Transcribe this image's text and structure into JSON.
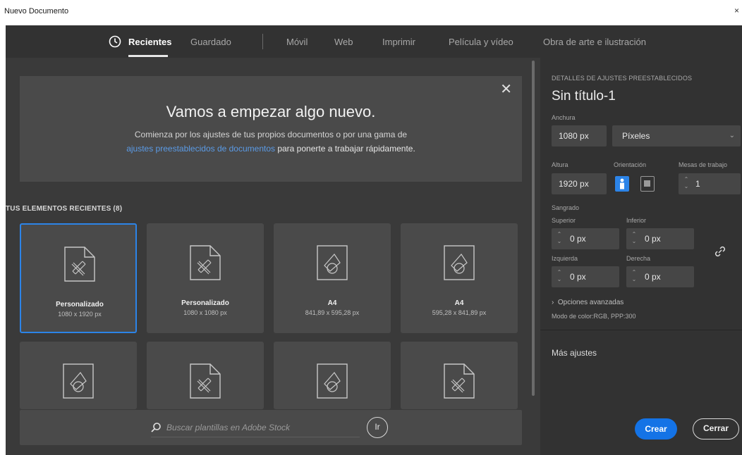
{
  "window": {
    "title": "Nuevo Documento"
  },
  "tabs": [
    {
      "label": "Recientes",
      "active": true
    },
    {
      "label": "Guardado"
    },
    {
      "label": "Móvil"
    },
    {
      "label": "Web"
    },
    {
      "label": "Imprimir"
    },
    {
      "label": "Película y vídeo"
    },
    {
      "label": "Obra de arte e ilustración"
    }
  ],
  "hero": {
    "heading": "Vamos a empezar algo nuevo.",
    "line1": "Comienza por los ajustes de tus propios documentos o por una gama de",
    "line2_link": "ajustes preestablecidos de documentos",
    "line2_rest": " para ponerte a trabajar rápidamente."
  },
  "recent": {
    "label": "TUS ELEMENTOS RECIENTES  (8)",
    "items": [
      {
        "name": "Personalizado",
        "size": "1080 x 1920 px",
        "icon": "custom-doc-icon",
        "selected": true
      },
      {
        "name": "Personalizado",
        "size": "1080 x 1080 px",
        "icon": "custom-doc-icon"
      },
      {
        "name": "A4",
        "size": "841,89 x 595,28 px",
        "icon": "print-doc-icon"
      },
      {
        "name": "A4",
        "size": "595,28 x 841,89 px",
        "icon": "print-doc-icon"
      },
      {
        "name": "",
        "size": "",
        "icon": "print-doc-icon"
      },
      {
        "name": "",
        "size": "",
        "icon": "custom-doc-icon"
      },
      {
        "name": "",
        "size": "",
        "icon": "print-doc-icon"
      },
      {
        "name": "",
        "size": "",
        "icon": "custom-doc-icon"
      }
    ]
  },
  "search": {
    "placeholder": "Buscar plantillas en Adobe Stock",
    "go_label": "Ir"
  },
  "details": {
    "heading": "DETALLES DE AJUSTES PREESTABLECIDOS",
    "doc_title": "Sin título-1",
    "width_label": "Anchura",
    "width_value": "1080 px",
    "unit": "Píxeles",
    "height_label": "Altura",
    "height_value": "1920 px",
    "orientation_label": "Orientación",
    "artboards_label": "Mesas de trabajo",
    "artboards_value": "1",
    "bleed_label": "Sangrado",
    "top_label": "Superior",
    "top_value": "0 px",
    "bottom_label": "Inferior",
    "bottom_value": "0 px",
    "left_label": "Izquierda",
    "left_value": "0 px",
    "right_label": "Derecha",
    "right_value": "0 px",
    "advanced": "Opciones avanzadas",
    "mode": "Modo de color:RGB, PPP:300",
    "more_settings": "Más ajustes",
    "create": "Crear",
    "close": "Cerrar"
  },
  "colors": {
    "accent": "#1473e6",
    "selected_border": "#2c84e8",
    "link": "#5b9be6"
  }
}
